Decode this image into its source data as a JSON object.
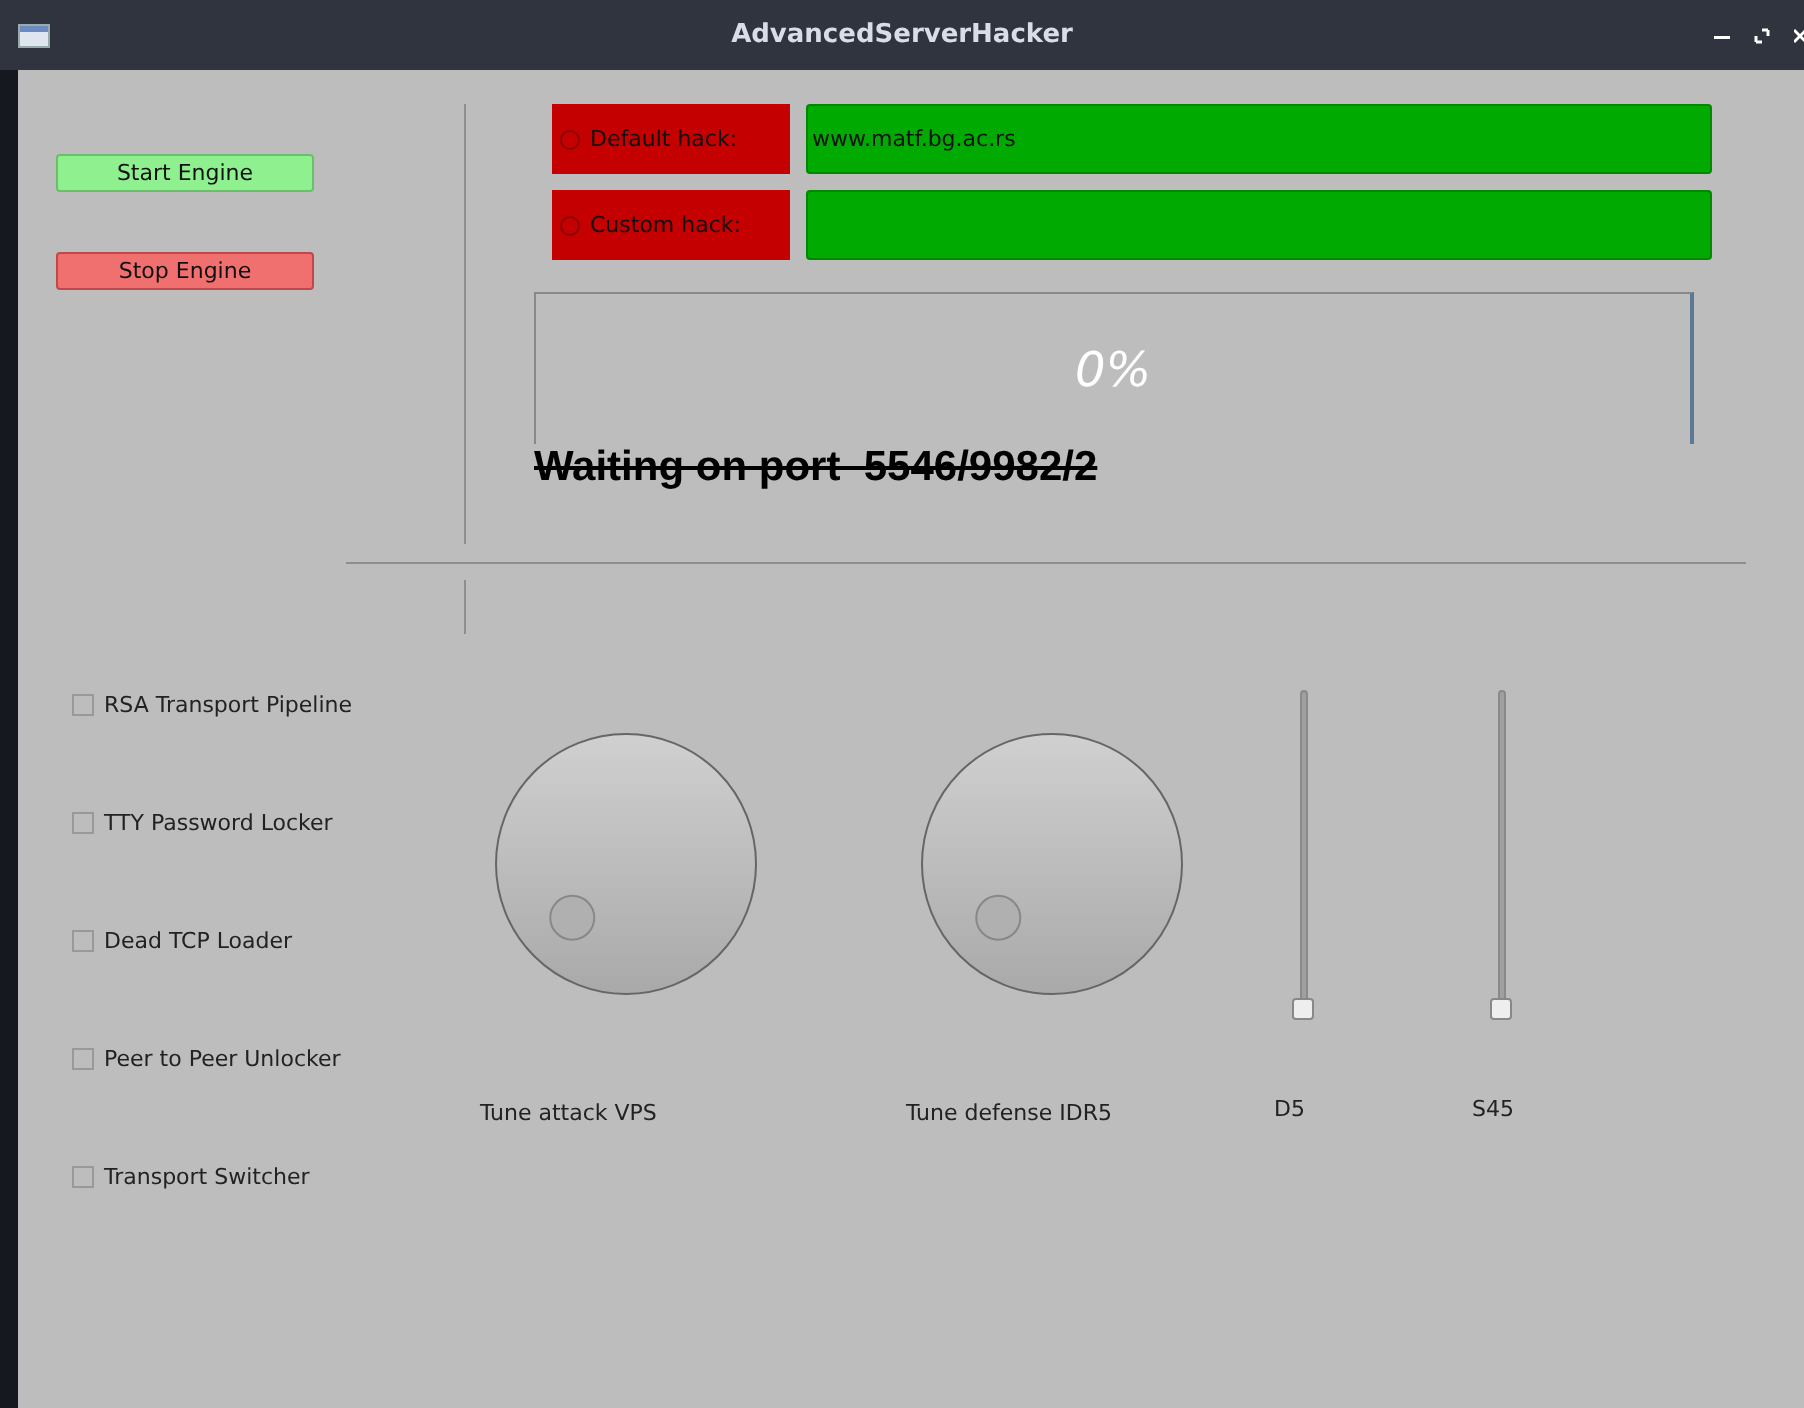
{
  "window": {
    "title": "AdvancedServerHacker"
  },
  "engine_buttons": [
    {
      "label": "Start Engine",
      "kind": "start"
    },
    {
      "label": "Stop Engine",
      "kind": "stop"
    }
  ],
  "hack_options": [
    {
      "label": "Default hack:",
      "selected": false,
      "value": "www.matf.bg.ac.rs"
    },
    {
      "label": "Custom hack:",
      "selected": false
    }
  ],
  "progress": {
    "level": 0,
    "reading": "0%"
  },
  "status": "Waiting on port  5546/9982/2",
  "checkboxes": [
    {
      "label": "RSA Transport Pipeline",
      "checked": false
    },
    {
      "label": "TTY Password Locker",
      "checked": false
    },
    {
      "label": "Dead TCP Loader",
      "checked": false
    },
    {
      "label": "Peer to Peer Unlocker",
      "checked": false
    },
    {
      "label": "Transport Switcher",
      "checked": false
    }
  ],
  "dials": [
    {
      "label": "Tune attack VPS"
    },
    {
      "label": "Tune defense IDR5"
    }
  ],
  "sliders": [
    {
      "label": "D5",
      "level": 0
    },
    {
      "label": "S45",
      "level": 0
    }
  ]
}
